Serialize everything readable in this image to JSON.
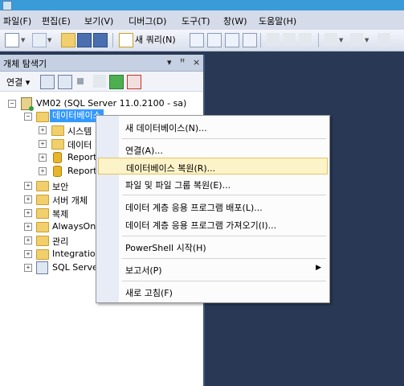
{
  "menu": [
    "파일(F)",
    "편집(E)",
    "보기(V)",
    "디버그(D)",
    "도구(T)",
    "창(W)",
    "도움말(H)"
  ],
  "toolbar": {
    "new_query": "새 쿼리(N)"
  },
  "object_explorer": {
    "title": "개체 탐색기",
    "connect_label": "연결",
    "server": "VM02 (SQL Server 11.0.2100 - sa)",
    "nodes": [
      "데이터베이스",
      "시스템",
      "데이터",
      "Report",
      "Report",
      "보안",
      "서버 개체",
      "복제",
      "AlwaysOn",
      "관리",
      "Integration",
      "SQL Serve"
    ]
  },
  "context_menu": {
    "items": [
      "새 데이터베이스(N)...",
      "연결(A)...",
      "데이터베이스 복원(R)...",
      "파일 및 파일 그룹 복원(E)...",
      "데이터 계층 응용 프로그램 배포(L)...",
      "데이터 계층 응용 프로그램 가져오기(I)...",
      "PowerShell 시작(H)",
      "보고서(P)",
      "새로 고침(F)"
    ],
    "highlighted_index": 2
  },
  "colors": {
    "workspace": "#293955",
    "selection": "#3399ff",
    "highlight": "#fdf3c8"
  }
}
